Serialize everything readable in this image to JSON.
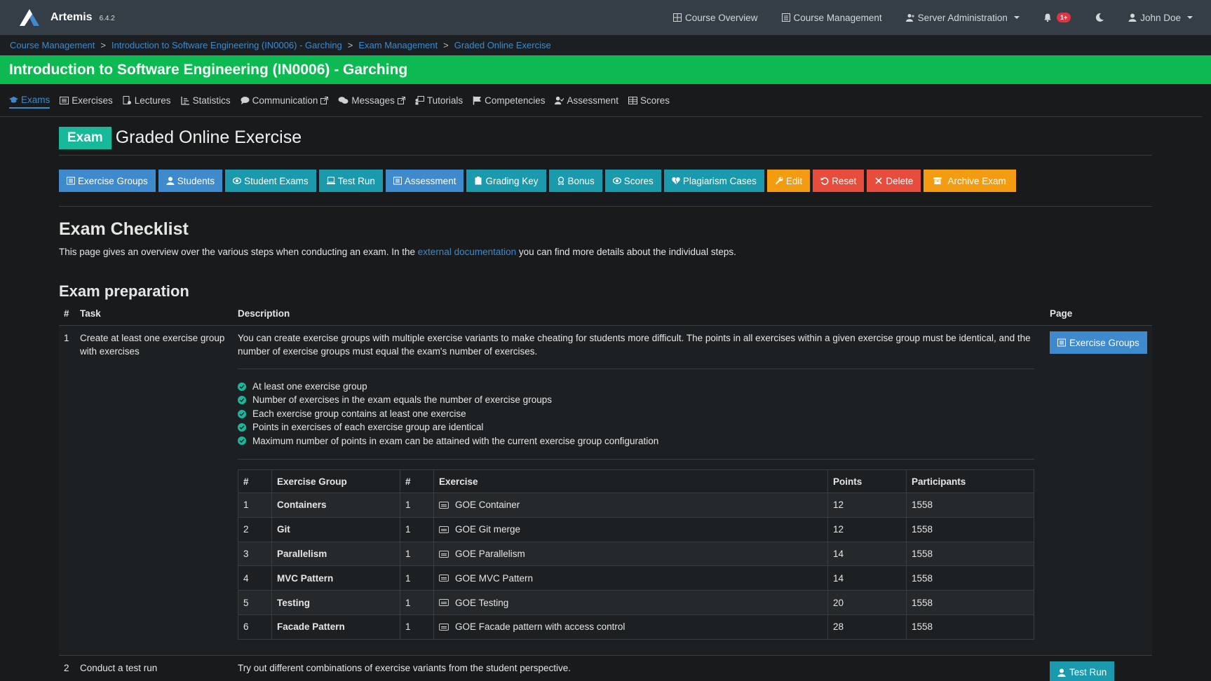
{
  "navbar": {
    "brand": "Artemis",
    "version": "6.4.2",
    "items": [
      {
        "label": "Course Overview",
        "icon": "grid-icon"
      },
      {
        "label": "Course Management",
        "icon": "list-icon"
      },
      {
        "label": "Server Administration",
        "icon": "user-plus-icon"
      }
    ],
    "notification_badge": "1+",
    "user": "John Doe"
  },
  "breadcrumb": [
    "Course Management",
    "Introduction to Software Engineering (IN0006) - Garching",
    "Exam Management",
    "Graded Online Exercise"
  ],
  "course": {
    "title": "Introduction to Software Engineering (IN0006) - Garching",
    "tabs": [
      "Exams",
      "Exercises",
      "Lectures",
      "Statistics",
      "Communication",
      "Messages",
      "Tutorials",
      "Competencies",
      "Assessment",
      "Scores"
    ]
  },
  "exam": {
    "badge": "Exam",
    "title": "Graded Online Exercise",
    "actions": [
      "Exercise Groups",
      "Students",
      "Student Exams",
      "Test Run",
      "Assessment",
      "Grading Key",
      "Bonus",
      "Scores",
      "Plagiarism Cases",
      "Edit",
      "Reset",
      "Delete",
      "Archive Exam"
    ]
  },
  "checklist": {
    "title": "Exam Checklist",
    "intro_before": "This page gives an overview over the various steps when conducting an exam. In the ",
    "intro_link": "external documentation",
    "intro_after": " you can find more details about the individual steps.",
    "section_title": "Exam preparation",
    "headers": {
      "num": "#",
      "task": "Task",
      "description": "Description",
      "page": "Page"
    },
    "tasks": [
      {
        "num": "1",
        "task": "Create at least one exercise group with exercises",
        "description": "You can create exercise groups with multiple exercise variants to make cheating for students more difficult. The points in all exercises within a given exercise group must be identical, and the number of exercise groups must equal the exam's number of exercises.",
        "checks": [
          "At least one exercise group",
          "Number of exercises in the exam equals the number of exercise groups",
          "Each exercise group contains at least one exercise",
          "Points in exercises of each exercise group are identical",
          "Maximum number of points in exam can be attained with the current exercise group configuration"
        ],
        "page_button": "Exercise Groups"
      },
      {
        "num": "2",
        "task": "Conduct a test run",
        "description": "Try out different combinations of exercise variants from the student perspective.",
        "page_button": "Test Run"
      }
    ],
    "groups_table": {
      "headers": [
        "#",
        "Exercise Group",
        "#",
        "Exercise",
        "Points",
        "Participants"
      ],
      "rows": [
        [
          "1",
          "Containers",
          "1",
          "GOE Container",
          "12",
          "1558"
        ],
        [
          "2",
          "Git",
          "1",
          "GOE Git merge",
          "12",
          "1558"
        ],
        [
          "3",
          "Parallelism",
          "1",
          "GOE Parallelism",
          "14",
          "1558"
        ],
        [
          "4",
          "MVC Pattern",
          "1",
          "GOE MVC Pattern",
          "14",
          "1558"
        ],
        [
          "5",
          "Testing",
          "1",
          "GOE Testing",
          "20",
          "1558"
        ],
        [
          "6",
          "Facade Pattern",
          "1",
          "GOE Facade pattern with access control",
          "28",
          "1558"
        ]
      ]
    }
  }
}
